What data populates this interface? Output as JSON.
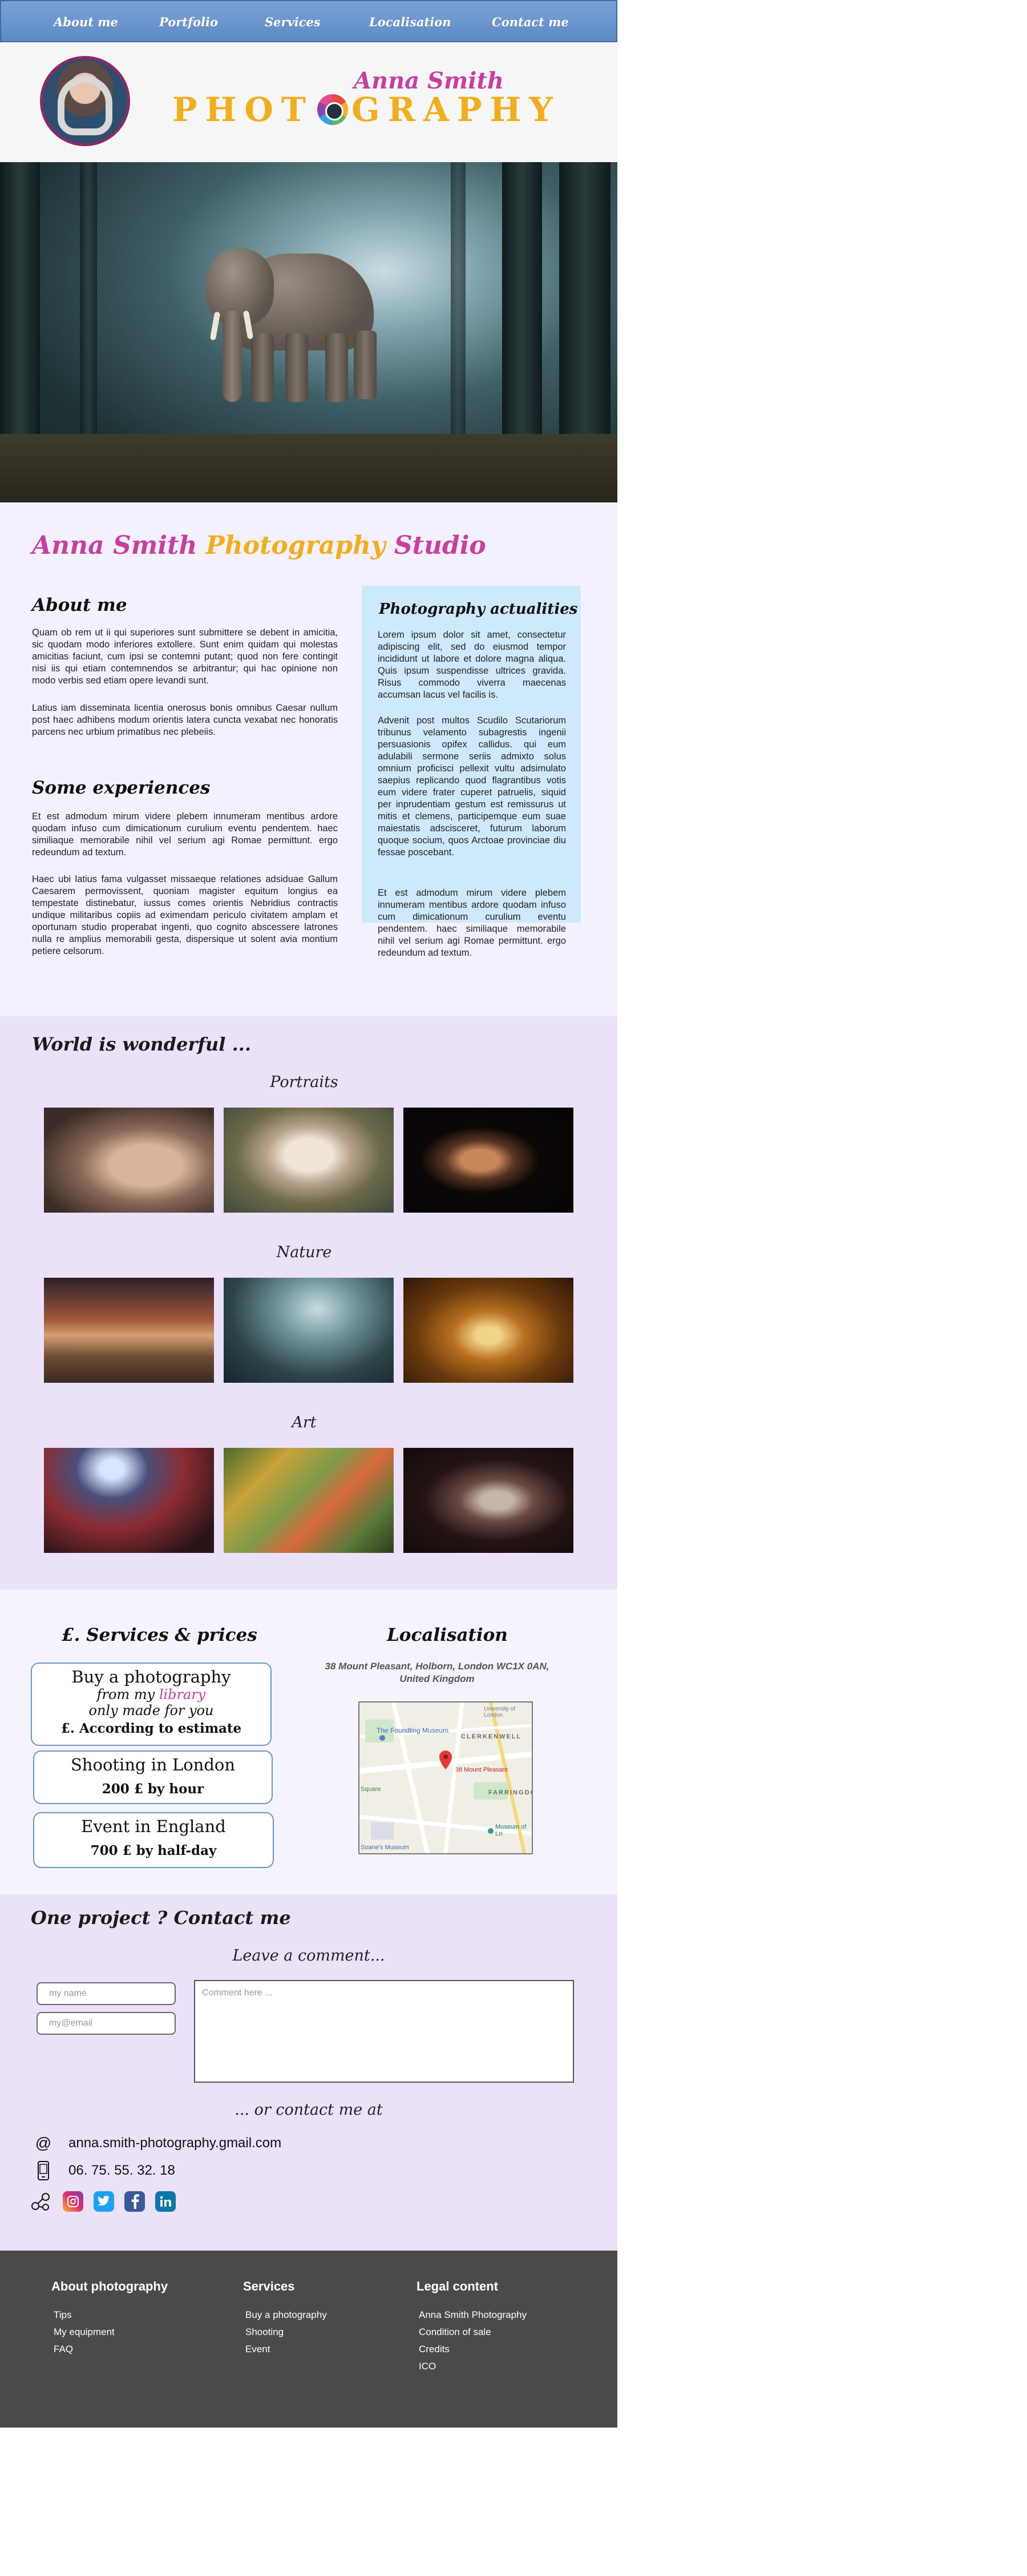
{
  "nav": {
    "items": [
      "About me",
      "Portfolio",
      "Services",
      "Localisation",
      "Contact me"
    ]
  },
  "header": {
    "name": "Anna Smith",
    "word_left": "PHOT",
    "word_right": "GRAPHY",
    "colors": {
      "pink": "#c83fa1",
      "gold": "#f2ad1c",
      "nav": "#6b96d0"
    }
  },
  "studio": {
    "title_part1": "Anna Smith",
    "title_part2": "Photography",
    "title_part3": "Studio",
    "about_title": "About me",
    "about_p1": "Quam ob rem ut ii qui superiores sunt submittere se debent in amicitia, sic quodam modo inferiores extollere. Sunt enim quidam qui molestas amicitias faciunt, cum ipsi se contemni putant; quod non fere contingit nisi iis qui etiam contemnendos se arbitrantur; qui hac opinione non modo verbis sed etiam opere levandi sunt.",
    "about_p2": "Latius iam disseminata licentia onerosus bonis omnibus Caesar nullum post haec adhibens modum orientis latera cuncta vexabat nec honoratis parcens nec urbium primatibus nec plebeiis.",
    "exp_title": "Some experiences",
    "exp_p1": "Et est admodum mirum videre plebem innumeram mentibus ardore quodam infuso cum dimicationum curulium eventu pendentem. haec similiaque memorabile nihil vel serium agi Romae permittunt. ergo redeundum ad textum.",
    "exp_p2": "Haec ubi latius fama vulgasset missaeque relationes adsiduae Gallum Caesarem permovissent, quoniam magister equitum longius ea tempestate distinebatur, iussus comes orientis Nebridius contractis undique militaribus copiis ad eximendam periculo civitatem amplam et oportunam studio properabat ingenti, quo cognito abscessere latrones nulla re amplius memorabili gesta, dispersique ut solent avia montium petiere celsorum.",
    "actu_title": "Photography actualities",
    "actu_p1": "Lorem ipsum dolor sit amet, consectetur adipiscing elit, sed do eiusmod tempor incididunt ut labore et dolore magna aliqua. Quis ipsum suspendisse ultrices gravida. Risus commodo viverra maecenas accumsan lacus vel facilis is.",
    "actu_p2": "Advenit post multos Scudilo Scutariorum tribunus velamento subagrestis ingenii persuasionis opifex callidus. qui eum adulabili sermone seriis admixto solus omnium proficisci pellexit vultu adsimulato saepius replicando quod flagrantibus votis eum videre frater cuperet patruelis, siquid per inprudentiam gestum est remissurus ut mitis et clemens, participemque eum suae maiestatis adscisceret, futurum laborum quoque socium, quos Arctoae provinciae diu fessae poscebant.",
    "actu_p3": "Et est admodum mirum videre plebem innumeram mentibus ardore quodam infuso cum dimicationum curulium eventu pendentem. haec similiaque memorabile nihil vel serium agi Romae permittunt. ergo redeundum ad textum."
  },
  "gallery": {
    "title": "World is wonderful ...",
    "categories": [
      "Portraits",
      "Nature",
      "Art"
    ]
  },
  "services": {
    "title": "£. Services & prices",
    "card1": {
      "title": "Buy a photography",
      "line1_pre": "from my",
      "line1_link": "library",
      "line2": "only made for you",
      "price": "£. According to estimate"
    },
    "card2": {
      "title": "Shooting in London",
      "price": "200 £ by hour"
    },
    "card3": {
      "title": "Event in England",
      "price": "700 £ by half-day"
    }
  },
  "localisation": {
    "title": "Localisation",
    "address": "38 Mount Pleasant, Holborn, London WC1X 0AN, United Kingdom",
    "map_labels": [
      "University of London",
      "The Foundling Museum",
      "CLERKENWELL",
      "38 Mount Pleasant",
      "Square",
      "FARRINGDO",
      "Museum of Lo",
      "Soane's Museum"
    ]
  },
  "contact": {
    "title": "One project ? Contact me",
    "leave_comment": "Leave a comment...",
    "name_placeholder": "my name",
    "email_placeholder": "my@email",
    "comment_placeholder": "Comment here ...",
    "or_contact": "... or contact me at",
    "email": "anna.smith-photography.gmail.com",
    "phone": "06. 75. 55. 32. 18",
    "social": [
      "instagram-icon",
      "twitter-icon",
      "facebook-icon",
      "linkedin-icon"
    ]
  },
  "footer": {
    "col1": {
      "title": "About photography",
      "links": [
        "Tips",
        "My equipment",
        "FAQ"
      ]
    },
    "col2": {
      "title": "Services",
      "links": [
        "Buy a photography",
        "Shooting",
        "Event"
      ]
    },
    "col3": {
      "title": "Legal content",
      "links": [
        "Anna Smith Photography",
        "Condition of sale",
        "Credits",
        "ICO"
      ]
    }
  }
}
